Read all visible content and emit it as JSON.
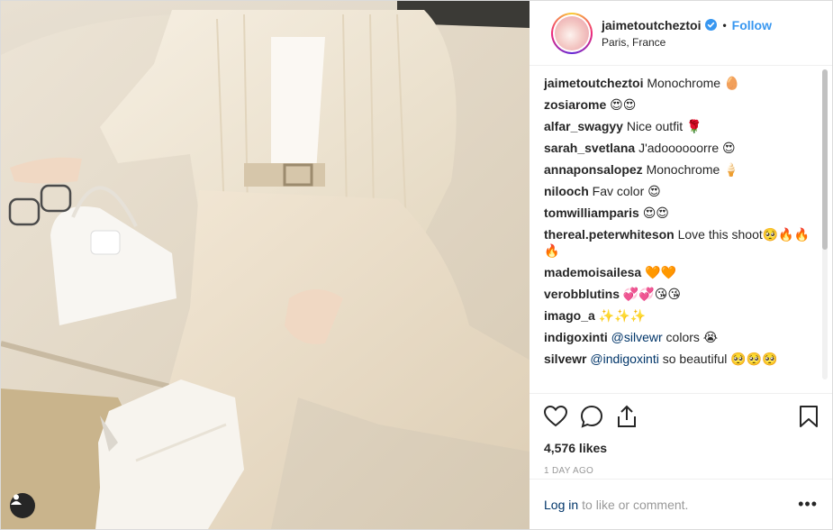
{
  "header": {
    "username": "jaimetoutcheztoi",
    "separator": "•",
    "follow_label": "Follow",
    "location": "Paris, France",
    "avatar_icon": "profile-avatar",
    "verified_icon": "verified-badge-icon",
    "verified_color": "#3897f0"
  },
  "comments": [
    {
      "user": "jaimetoutcheztoi",
      "text": " Monochrome 🥚"
    },
    {
      "user": "zosiarome",
      "text": " 😍😍"
    },
    {
      "user": "alfar_swagyy",
      "text": " Nice outfit 🌹"
    },
    {
      "user": "sarah_svetlana",
      "text": " J'adoooooorre 😍"
    },
    {
      "user": "annaponsalopez",
      "text": " Monochrome 🍦"
    },
    {
      "user": "nilooch",
      "text": " Fav color 😍"
    },
    {
      "user": "tomwilliamparis",
      "text": " 😍😍"
    },
    {
      "user": "thereal.peterwhiteson",
      "text": " Love this shoot🥺🔥🔥🔥"
    },
    {
      "user": "mademoisailesa",
      "text": " 🧡🧡"
    },
    {
      "user": "verobblutins",
      "text": " 💞💞😘😘"
    },
    {
      "user": "imago_a",
      "text": " ✨✨✨"
    },
    {
      "user": "indigoxinti",
      "mention": " @silvewr",
      "text": " colors 😭"
    },
    {
      "user": "silvewr",
      "mention": " @indigoxinti",
      "text": " so beautiful 🥺🥺🥺"
    }
  ],
  "actions": {
    "like_icon": "heart-icon",
    "comment_icon": "comment-icon",
    "share_icon": "share-icon",
    "save_icon": "bookmark-icon"
  },
  "likes": "4,576 likes",
  "date": "1 DAY AGO",
  "footer": {
    "login_label": "Log in",
    "suffix": "to like or comment.",
    "more_label": "•••"
  },
  "colors": {
    "link_blue": "#3897f0",
    "dark_link": "#003569",
    "text": "#262626",
    "muted": "#999999",
    "border": "#efefef"
  }
}
